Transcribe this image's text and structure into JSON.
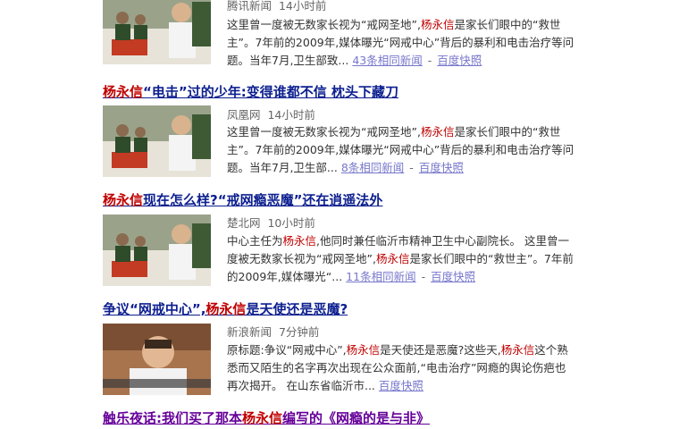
{
  "results": [
    {
      "title": null,
      "source": "腾讯新闻",
      "time": "14小时前",
      "snippet": [
        {
          "t": "这里曾一度被无数家长视为“戒网圣地”,"
        },
        {
          "t": "杨永信",
          "hl": true
        },
        {
          "t": "是家长们眼中的“救世主”。7年前的2009年,媒体曝光“网戒中心”背后的暴利和电击治疗等问题。当年7月,卫生部致..."
        }
      ],
      "more": "43条相同新闻",
      "cache": "百度快照"
    },
    {
      "title": [
        {
          "t": "杨永信",
          "hl": true
        },
        {
          "t": "“电击”过的少年:变得谁都不信 枕头下藏刀"
        }
      ],
      "source": "凤凰网",
      "time": "14小时前",
      "snippet": [
        {
          "t": "这里曾一度被无数家长视为“戒网圣地”,"
        },
        {
          "t": "杨永信",
          "hl": true
        },
        {
          "t": "是家长们眼中的“救世主”。7年前的2009年,媒体曝光“网戒中心”背后的暴利和电击治疗等问题。当年7月,卫生部..."
        }
      ],
      "more": "8条相同新闻",
      "cache": "百度快照"
    },
    {
      "title": [
        {
          "t": "杨永信",
          "hl": true
        },
        {
          "t": "现在怎么样?“戒网瘾恶魔”还在逍遥法外"
        }
      ],
      "source": "楚北网",
      "time": "10小时前",
      "snippet": [
        {
          "t": "中心主任为"
        },
        {
          "t": "杨永信",
          "hl": true
        },
        {
          "t": ",他同时兼任临沂市精神卫生中心副院长。 这里曾一度被无数家长视为“戒网圣地”,"
        },
        {
          "t": "杨永信",
          "hl": true
        },
        {
          "t": "是家长们眼中的“救世主”。7年前的2009年,媒体曝光“..."
        }
      ],
      "more": "11条相同新闻",
      "cache": "百度快照"
    },
    {
      "title": [
        {
          "t": "争议“网戒中心”,"
        },
        {
          "t": "杨永信",
          "hl": true
        },
        {
          "t": "是天使还是恶魔?"
        }
      ],
      "source": "新浪新闻",
      "time": "7分钟前",
      "snippet": [
        {
          "t": "原标题:争议“网戒中心”,"
        },
        {
          "t": "杨永信",
          "hl": true
        },
        {
          "t": "是天使还是恶魔?这些天,"
        },
        {
          "t": "杨永信",
          "hl": true
        },
        {
          "t": "这个熟悉而又陌生的名字再次出现在公众面前,“电击治疗”网瘾的舆论伤疤也再次揭开。 在山东省临沂市..."
        }
      ],
      "more": null,
      "cache": "百度快照"
    },
    {
      "title": [
        {
          "t": "触乐夜话:我们买了那本"
        },
        {
          "t": "杨永信",
          "hl": true
        },
        {
          "t": "编写的《网瘾的是与非》"
        }
      ],
      "visited": true,
      "source": null,
      "time": null,
      "snippet": null,
      "more": null,
      "cache": null
    }
  ],
  "colors": {
    "title_link": "#0c1f8f",
    "title_visited": "#660099",
    "highlight": "#c00000",
    "meta": "#666666",
    "snippet": "#333333"
  }
}
